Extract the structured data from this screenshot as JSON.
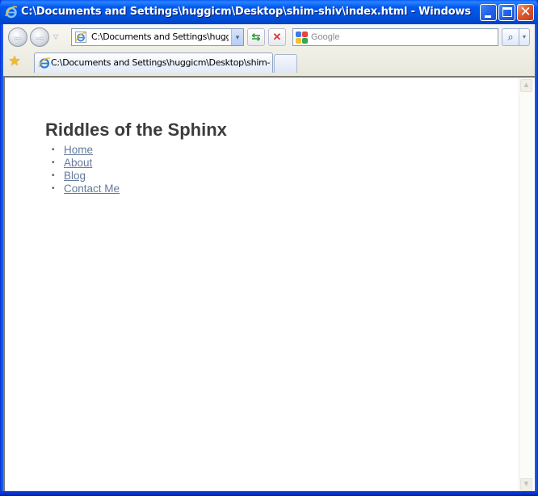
{
  "window": {
    "title": "C:\\Documents and Settings\\huggicm\\Desktop\\shim-shiv\\index.html - Windows Internet E...",
    "controls": {
      "minimize_icon": "minimize-icon",
      "maximize_icon": "maximize-icon",
      "close_glyph": "✕"
    }
  },
  "toolbar": {
    "back_glyph": "←",
    "forward_glyph": "→",
    "recent_pages_glyph": "▽",
    "address_value": "C:\\Documents and Settings\\huggicm\\Desktop\\shim-shiv\\index.html",
    "address_dropdown_glyph": "▾",
    "refresh_glyph": "⇆",
    "stop_glyph": "✕",
    "search_placeholder": "Google",
    "search_go_glyph": "⌕",
    "search_options_glyph": "▾"
  },
  "tabs": {
    "favorites_glyph": "★",
    "items": [
      {
        "title": "C:\\Documents and Settings\\huggicm\\Desktop\\shim-shi...",
        "active": true
      }
    ]
  },
  "page": {
    "heading": "Riddles of the Sphinx",
    "nav_links": [
      {
        "label": "Home"
      },
      {
        "label": "About"
      },
      {
        "label": "Blog"
      },
      {
        "label": "Contact Me"
      }
    ],
    "bullet": "•"
  },
  "scrollbar": {
    "up_glyph": "▲",
    "down_glyph": "▼"
  },
  "colors": {
    "titlebar": "#0054e3",
    "heading_text": "#3c3c3c",
    "link": "#65799a",
    "chrome_bg": "#efeee5"
  }
}
